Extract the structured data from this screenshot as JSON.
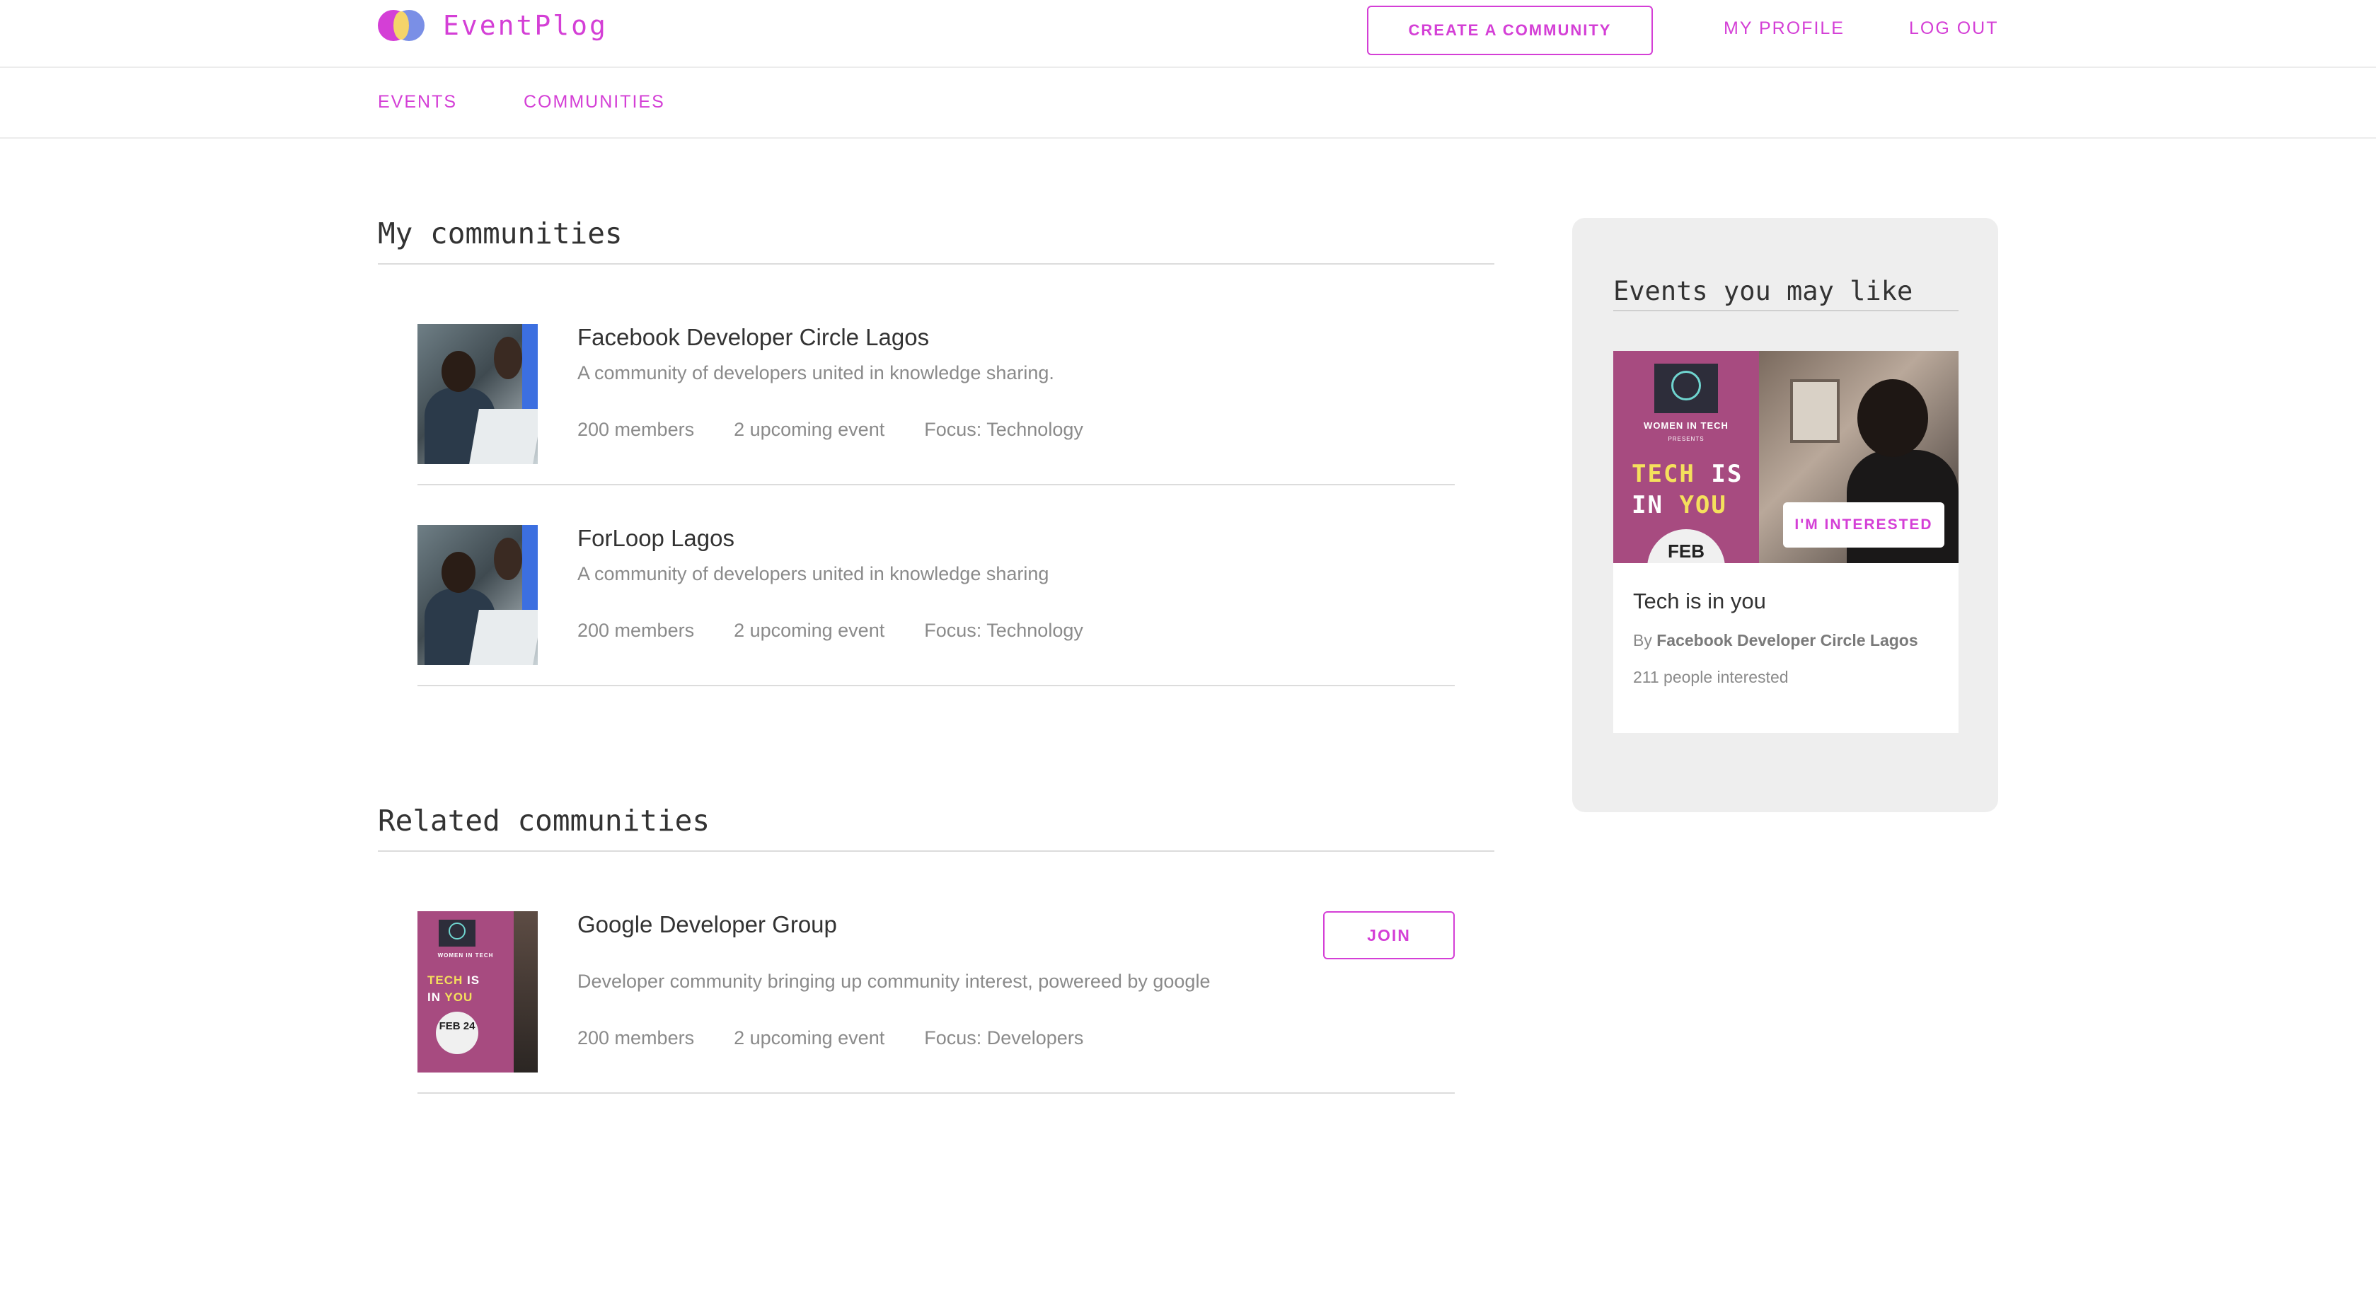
{
  "app": {
    "name": "EventPlog",
    "accent": "#d43fd6"
  },
  "header": {
    "create_label": "CREATE A COMMUNITY",
    "profile_label": "MY PROFILE",
    "logout_label": "LOG OUT"
  },
  "subnav": {
    "events_label": "EVENTS",
    "communities_label": "COMMUNITIES"
  },
  "my_communities": {
    "title": "My communities",
    "items": [
      {
        "name": "Facebook Developer Circle Lagos",
        "description": "A community of developers united in knowledge sharing.",
        "members": "200 members",
        "events": "2 upcoming event",
        "focus": "Focus: Technology"
      },
      {
        "name": "ForLoop Lagos",
        "description": "A community of developers united in knowledge sharing",
        "members": "200 members",
        "events": "2 upcoming event",
        "focus": "Focus: Technology"
      }
    ]
  },
  "related_communities": {
    "title": "Related communities",
    "items": [
      {
        "name": "Google Developer Group",
        "description": "Developer community bringing up community interest, powereed by google",
        "members": "200 members",
        "events": "2 upcoming event",
        "focus": "Focus: Developers",
        "join_label": "JOIN",
        "poster": {
          "org": "WOMEN IN TECH",
          "line1a": "TECH",
          "line1b": "IS",
          "line2a": "IN",
          "line2b": "YOU",
          "date": "FEB 24"
        }
      }
    ]
  },
  "sidebar": {
    "title": "Events you may like",
    "event": {
      "title": "Tech is in you",
      "by_prefix": "By",
      "by_org": "Facebook Developer Circle Lagos",
      "interested": "211 people interested",
      "interest_label": "I'M INTERESTED",
      "poster": {
        "org": "WOMEN IN TECH",
        "presents": "PRESENTS",
        "line1a": "TECH",
        "line1b": "IS",
        "line2a": "IN",
        "line2b": "YOU",
        "date": "FEB"
      }
    }
  }
}
